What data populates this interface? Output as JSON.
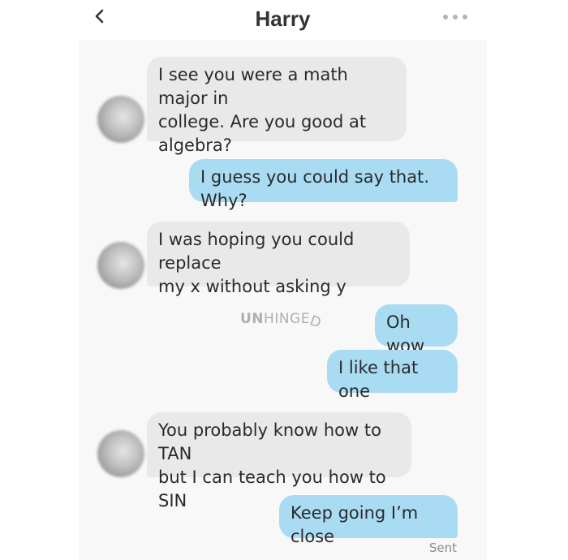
{
  "header": {
    "contact_name": "Harry",
    "back_icon": "chevron-left-icon",
    "more_icon": "more-dots-icon"
  },
  "messages": [
    {
      "direction": "incoming",
      "text": "I see you were a math major in\ncollege. Are you good at\nalgebra?"
    },
    {
      "direction": "outgoing",
      "text": "I guess you could say that. Why?"
    },
    {
      "direction": "incoming",
      "text": "I was hoping you could replace\nmy x without asking y"
    },
    {
      "direction": "outgoing",
      "text": "Oh wow"
    },
    {
      "direction": "outgoing",
      "text": "I like that one"
    },
    {
      "direction": "incoming",
      "text": "You probably know how to TAN\nbut I can teach you how to SIN"
    },
    {
      "direction": "outgoing",
      "text": "Keep going I’m close"
    }
  ],
  "watermark": {
    "bold": "UN",
    "regular": "HINGE",
    "tail": "D"
  },
  "status": {
    "sent": "Sent"
  },
  "colors": {
    "incoming_bubble": "#e9e9ea",
    "outgoing_bubble": "#a9dcf3",
    "chat_background": "#f8f8f8"
  }
}
